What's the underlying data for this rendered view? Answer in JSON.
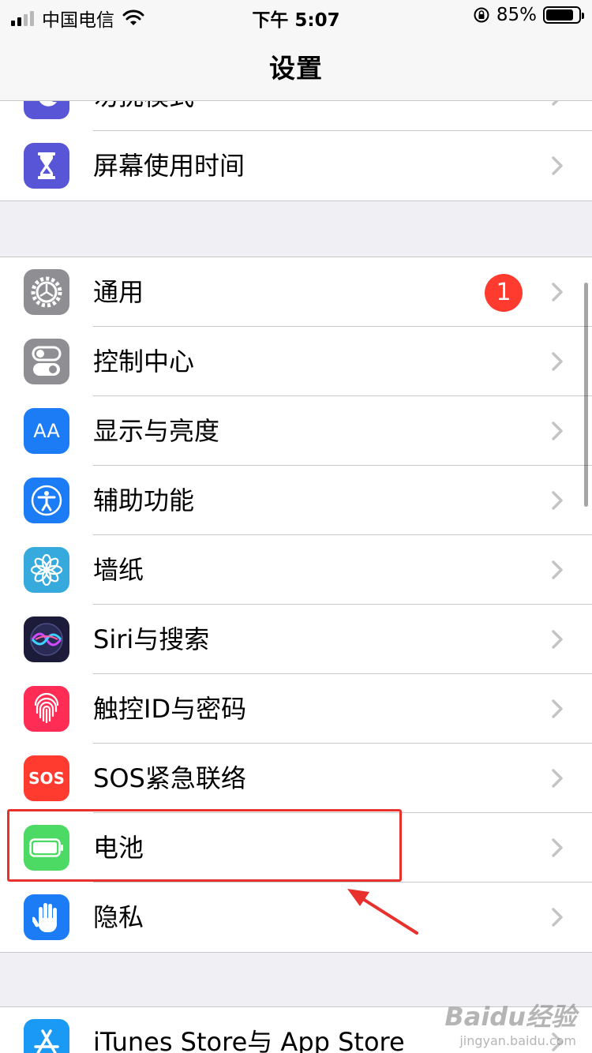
{
  "status_bar": {
    "carrier": "中国电信",
    "time": "下午 5:07",
    "battery_percent": "85%",
    "battery_level": 0.85
  },
  "nav": {
    "title": "设置"
  },
  "group1": {
    "items": [
      {
        "label": "勿扰模式",
        "icon": "moon-icon",
        "color": "#5856d6"
      },
      {
        "label": "屏幕使用时间",
        "icon": "hourglass-icon",
        "color": "#5856d6"
      }
    ]
  },
  "group2": {
    "items": [
      {
        "label": "通用",
        "icon": "gear-icon",
        "color": "#8e8e93",
        "badge": "1"
      },
      {
        "label": "控制中心",
        "icon": "toggles-icon",
        "color": "#8e8e93"
      },
      {
        "label": "显示与亮度",
        "icon": "text-size-icon",
        "color": "#1b7cf5",
        "icon_text": "AA"
      },
      {
        "label": "辅助功能",
        "icon": "accessibility-icon",
        "color": "#1b7cf5"
      },
      {
        "label": "墙纸",
        "icon": "flower-icon",
        "color": "#36aadc"
      },
      {
        "label": "Siri与搜索",
        "icon": "siri-icon",
        "color": "#1c1c3a"
      },
      {
        "label": "触控ID与密码",
        "icon": "fingerprint-icon",
        "color": "#ff2d55"
      },
      {
        "label": "SOS紧急联络",
        "icon": "sos-icon",
        "color": "#ff3b30",
        "icon_text": "SOS"
      },
      {
        "label": "电池",
        "icon": "battery-icon",
        "color": "#4cd964"
      },
      {
        "label": "隐私",
        "icon": "hand-icon",
        "color": "#1b7cf5"
      }
    ]
  },
  "group3": {
    "items": [
      {
        "label": "iTunes Store与 App Store",
        "icon": "app-store-icon",
        "color": "#1b9af5"
      }
    ]
  },
  "watermark": {
    "logo": "Baidu经验",
    "sub": "jingyan.baidu.com"
  }
}
